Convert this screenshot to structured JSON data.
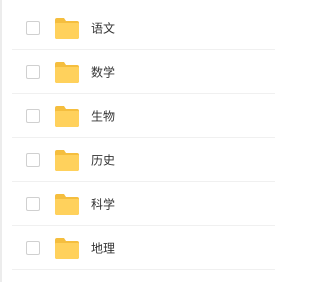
{
  "colors": {
    "folder": "#FFD15C",
    "folder_tab": "#F5BE3E",
    "checkbox_border": "#D0D0D0",
    "text": "#333333",
    "divider": "#F0F0F0"
  },
  "items": [
    {
      "label": "语文",
      "icon": "folder-icon",
      "checked": false
    },
    {
      "label": "数学",
      "icon": "folder-icon",
      "checked": false
    },
    {
      "label": "生物",
      "icon": "folder-icon",
      "checked": false
    },
    {
      "label": "历史",
      "icon": "folder-icon",
      "checked": false
    },
    {
      "label": "科学",
      "icon": "folder-icon",
      "checked": false
    },
    {
      "label": "地理",
      "icon": "folder-icon",
      "checked": false
    }
  ]
}
